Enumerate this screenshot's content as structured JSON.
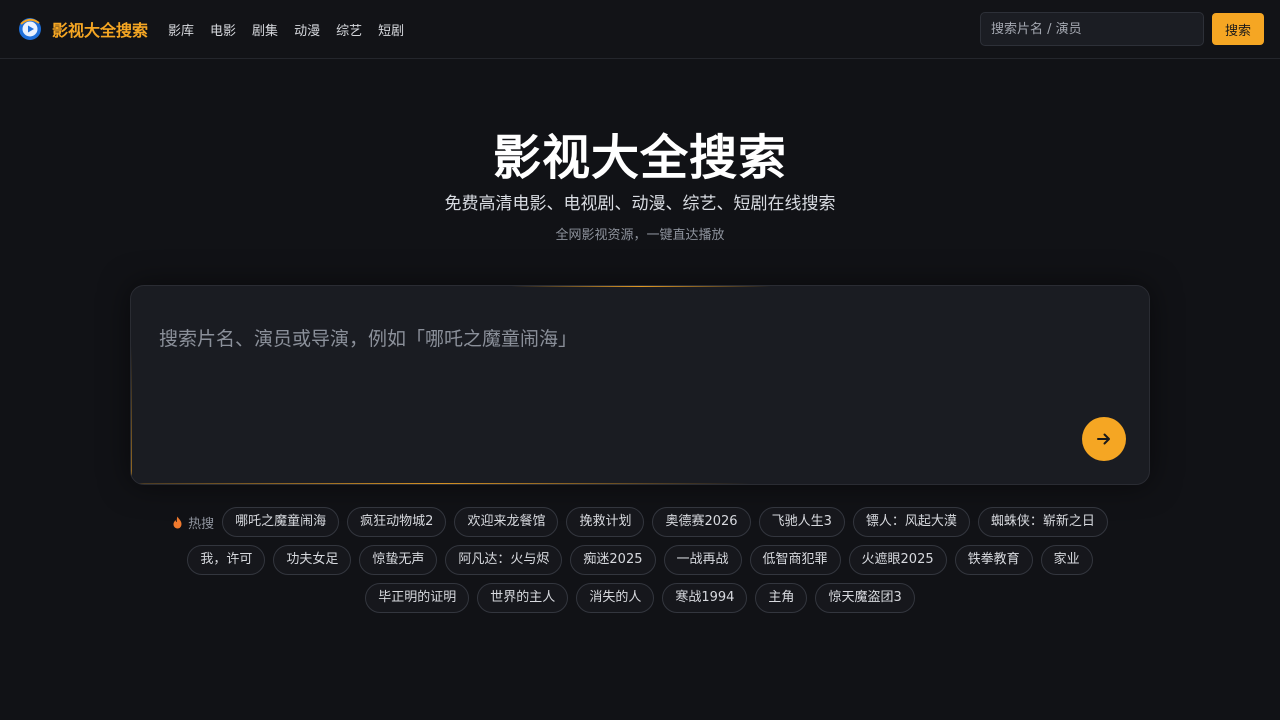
{
  "header": {
    "brand_name": "影视大全搜索",
    "nav": [
      "影库",
      "电影",
      "剧集",
      "动漫",
      "综艺",
      "短剧"
    ],
    "search_placeholder": "搜索片名 / 演员",
    "search_button": "搜索"
  },
  "hero": {
    "title": "影视大全搜索",
    "subtitle": "免费高清电影、电视剧、动漫、综艺、短剧在线搜索",
    "note": "全网影视资源，一键直达播放"
  },
  "search": {
    "placeholder": "搜索片名、演员或导演，例如「哪吒之魔童闹海」",
    "submit_icon": "arrow-right-icon"
  },
  "hot": {
    "label": "热搜",
    "icon": "flame-icon",
    "tags": [
      "哪吒之魔童闹海",
      "疯狂动物城2",
      "欢迎来龙餐馆",
      "挽救计划",
      "奥德赛2026",
      "飞驰人生3",
      "镖人：风起大漠",
      "蜘蛛侠：崭新之日",
      "我，许可",
      "功夫女足",
      "惊蛰无声",
      "阿凡达：火与烬",
      "痴迷2025",
      "一战再战",
      "低智商犯罪",
      "火遮眼2025",
      "铁拳教育",
      "家业",
      "毕正明的证明",
      "世界的主人",
      "消失的人",
      "寒战1994",
      "主角",
      "惊天魔盗团3"
    ]
  },
  "colors": {
    "accent": "#f5a623",
    "background": "#111216",
    "panel": "#1a1c22"
  }
}
